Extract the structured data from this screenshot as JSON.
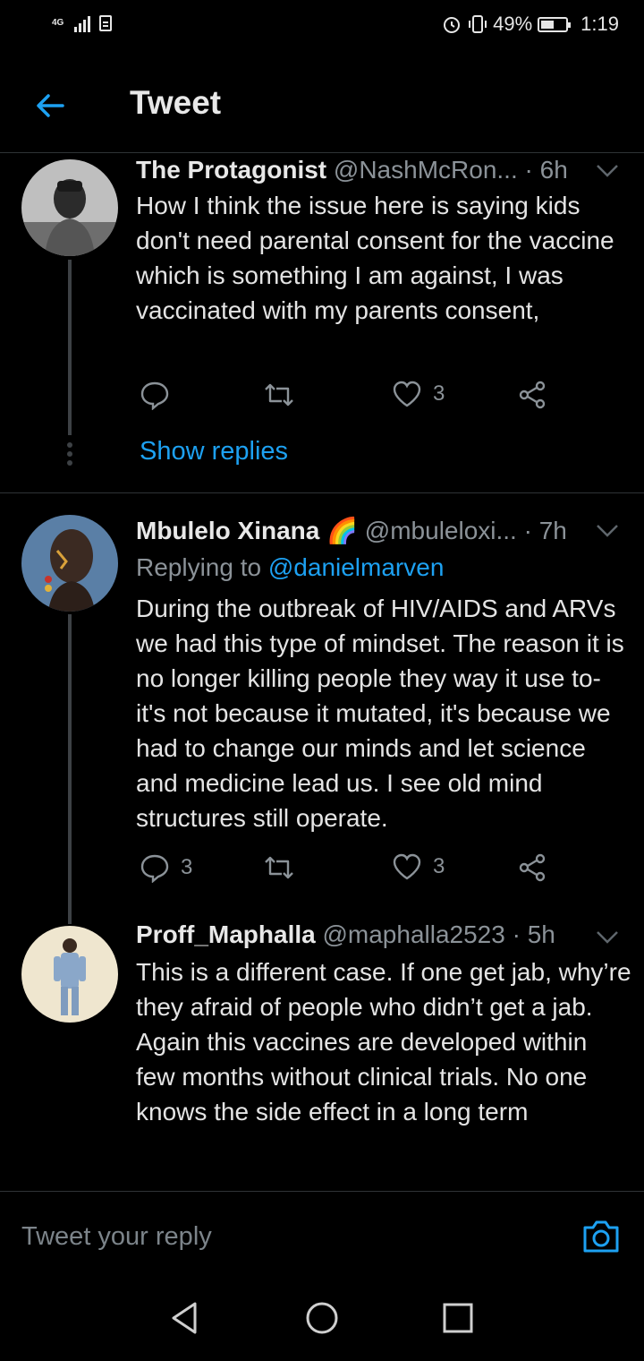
{
  "status_bar": {
    "network": "4G",
    "battery_percent": "49%",
    "time": "1:19"
  },
  "header": {
    "title": "Tweet"
  },
  "tweets": [
    {
      "name": "The Protagonist",
      "handle": "@NashMcRon...",
      "time": "· 6h",
      "text": "How I think the issue here is saying kids don't need parental consent for the vaccine which is something I am against, I was vaccinated with my parents consent,",
      "replies": "",
      "retweets": "",
      "likes": "3",
      "show_replies": "Show replies"
    },
    {
      "name": "Mbulelo Xinana",
      "emoji": "🌈",
      "handle": "@mbuleloxi...",
      "time": "· 7h",
      "replying_prefix": "Replying to",
      "replying_handle": "@danielmarven",
      "text": "During the outbreak of HIV/AIDS and ARVs we had this type of mindset. The reason it is no longer killing people they way it use to- it's not because it mutated, it's because we had to change our minds and let science and medicine lead us. I see old mind structures still operate.",
      "replies": "3",
      "retweets": "",
      "likes": "3"
    },
    {
      "name": "Proff_Maphalla",
      "handle": "@maphalla2523",
      "time": "· 5h",
      "text": "This is a different case. If one get jab, why’re they afraid of people who didn’t get a jab. Again this vaccines are developed within few months without clinical trials. No one knows the side effect in a long term"
    }
  ],
  "compose": {
    "placeholder": "Tweet your reply"
  },
  "colors": {
    "accent": "#1da1f2",
    "background": "#000000",
    "muted": "#8b9298"
  }
}
